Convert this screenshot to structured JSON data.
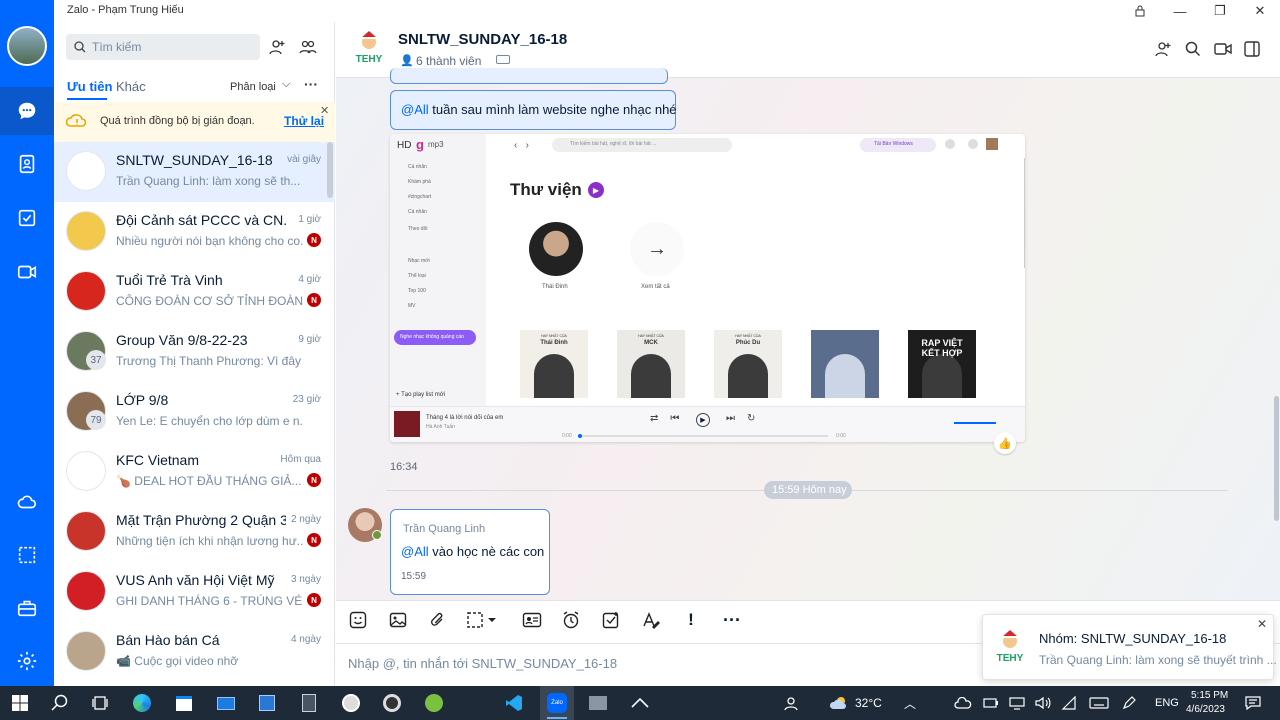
{
  "window": {
    "title": "Zalo - Phạm Trung Hiếu"
  },
  "nav": {
    "items": [
      "message-icon",
      "contacts-icon",
      "todo-icon",
      "video-icon",
      "cloud-icon",
      "screenshot-icon",
      "toolbox-icon",
      "settings-icon"
    ]
  },
  "list": {
    "search_placeholder": "Tìm kiếm",
    "tab_priority": "Ưu tiên",
    "tab_other": "Khác",
    "filter_label": "Phân loại",
    "sync_warning": "Quá trình đồng bộ bị gián đoạn.",
    "retry": "Thử lại",
    "conversations": [
      {
        "name": "SNLTW_SUNDAY_16-18",
        "time": "vài giây",
        "preview": "Trần Quang Linh: làm xong sẽ th...",
        "badge": "",
        "avatar_color": "#ffffff"
      },
      {
        "name": "Đội Cảnh sát PCCC và CN...",
        "time": "1 giờ",
        "preview": "Nhiều người nói bạn không cho co...",
        "badge": "N",
        "avatar_color": "#f2c94c"
      },
      {
        "name": "Tuổi Trẻ Trà Vinh",
        "time": "4 giờ",
        "preview": "CÔNG ĐOÀN CƠ SỞ TỈNH ĐOÀN: ...",
        "badge": "N",
        "avatar_color": "#d7261e"
      },
      {
        "name": "Group Văn 9/8-22-23",
        "time": "9 giờ",
        "preview": "Trương Thị Thanh Phương: Vì đây l...",
        "badge": "",
        "count": "37",
        "avatar_color": "#6b7a5e"
      },
      {
        "name": "LỚP 9/8",
        "time": "23 giờ",
        "preview": "Yen Le: E chuyển cho lớp dùm e n...",
        "badge": "",
        "count": "79",
        "avatar_color": "#8a6d52"
      },
      {
        "name": "KFC Vietnam",
        "time": "Hôm qua",
        "preview": "🍗 DEAL HOT ĐẦU THÁNG GIẢ...",
        "badge": "N",
        "avatar_color": "#ffffff"
      },
      {
        "name": "Mặt Trận Phường 2 Quận 3",
        "time": "2 ngày",
        "preview": "Những tiện ích khi nhận lương hư...",
        "badge": "N",
        "avatar_color": "#c9342a"
      },
      {
        "name": "VUS Anh văn Hội Việt Mỹ",
        "time": "3 ngày",
        "preview": "GHI DANH THÁNG 6 - TRÚNG VÉ ...",
        "badge": "N",
        "avatar_color": "#d21f26"
      },
      {
        "name": "Bán Hào bán Cá",
        "time": "4 ngày",
        "preview": "📹 Cuộc gọi video nhỡ",
        "badge": "",
        "avatar_color": "#b9a58c"
      }
    ]
  },
  "chat": {
    "title": "SNLTW_SUNDAY_16-18",
    "members": "6 thành viên",
    "msg1_mention": "@All",
    "msg1_text": " tuần sau mình làm website nghe nhạc nhé",
    "image_time": "16:34",
    "divider": "15:59 Hôm nay",
    "msg2_sender": "Trần Quang Linh",
    "msg2_mention": "@All",
    "msg2_text": " vào học nè các con",
    "msg2_time": "15:59",
    "input_placeholder": "Nhập @, tin nhắn tới SNLTW_SUNDAY_16-18"
  },
  "screenshot": {
    "logo_hd": "HD",
    "logo_mp3": "mp3",
    "search_ph": "Tìm kiếm bài hát, nghệ sĩ, lời bài hát ...",
    "download_btn": "Tải Bản Windows",
    "library_title": "Thư viện",
    "artist_name": "Thái Đinh",
    "see_all": "Xem tất cả",
    "side_items": [
      "Cá nhân",
      "Khám phá",
      "#zingchart",
      "Cá nhân",
      "Theo dõi",
      "Nhạc mới",
      "Thể loại",
      "Top 100",
      "MV"
    ],
    "promo": "Nghe nhạc không quảng cáo",
    "new_playlist": "Tạo play list mới",
    "albums": [
      {
        "top": "HAY NHẤT CỦA",
        "name": "Thái Đinh"
      },
      {
        "top": "HAY NHẤT CỦA",
        "name": "MCK"
      },
      {
        "top": "HAY NHẤT CỦA",
        "name": "Phúc Du"
      },
      {
        "top": "",
        "name": ""
      },
      {
        "top": "RAP VIỆT",
        "name": "KẾT HỢP"
      }
    ],
    "now_playing": "Tháng 4 là lời nói dối của em",
    "now_artist": "Hà Anh Tuấn",
    "time_left": "0:00",
    "time_right": "0:00"
  },
  "notification": {
    "title": "Nhóm: SNLTW_SUNDAY_16-18",
    "body": "Trần Quang Linh: làm xong sẽ thuyết trình ..."
  },
  "taskbar": {
    "temperature": "32°C",
    "lang": "ENG",
    "time": "5:15 PM",
    "date": "4/6/2023"
  },
  "colors": {
    "accent": "#0068ff",
    "bubble": "#e5efff",
    "badge": "#c00000",
    "taskbar": "#1f2a38"
  }
}
